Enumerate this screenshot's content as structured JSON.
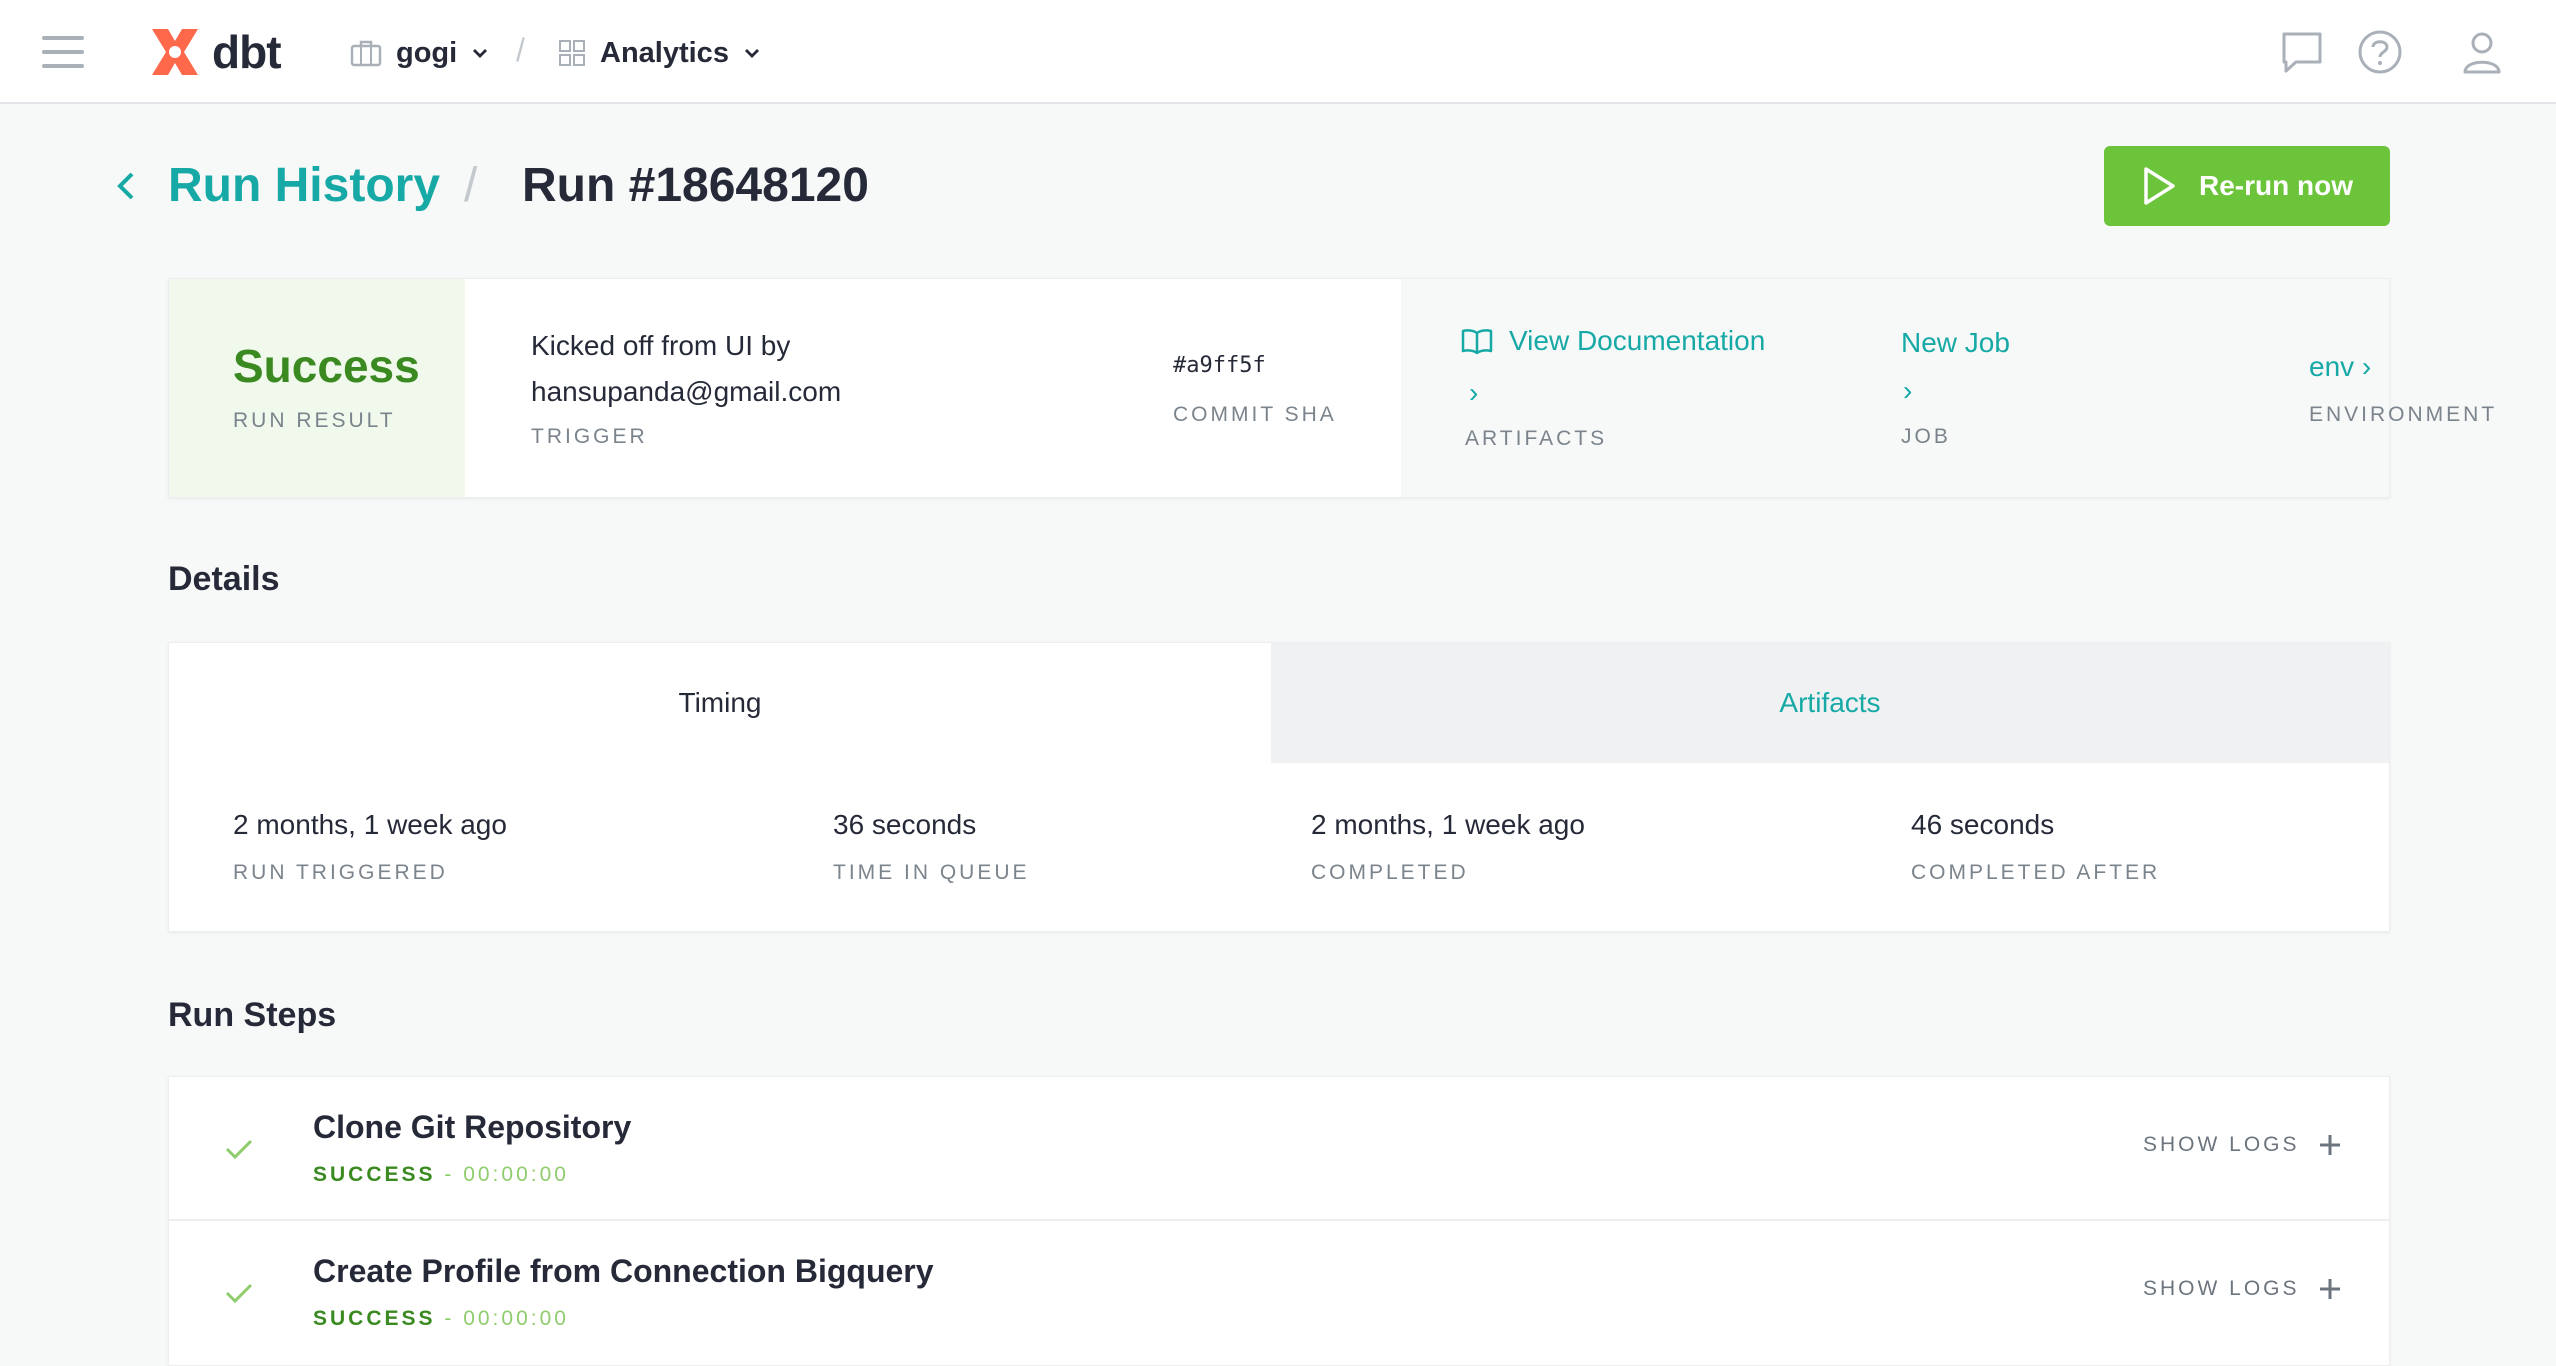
{
  "nav": {
    "logo_text": "dbt",
    "account": "gogi",
    "separator": "/",
    "project": "Analytics",
    "icons": [
      "menu-icon",
      "chat-icon",
      "help-icon",
      "user-icon"
    ],
    "brand_color": "#ff694b"
  },
  "header": {
    "back_link": "Run History",
    "separator": "/",
    "title": "Run #18648120",
    "rerun_label": "Re-run now",
    "rerun_color": "#6bc43a"
  },
  "summary": {
    "result_value": "Success",
    "result_label": "RUN RESULT",
    "trigger_text": "Kicked off from UI by hansupanda@gmail.com",
    "trigger_label": "TRIGGER",
    "commit_sha": "#a9ff5f",
    "commit_label": "COMMIT SHA",
    "artifacts_link": "View Documentation",
    "artifacts_chevron": "›",
    "artifacts_label": "ARTIFACTS",
    "job_link": "New Job",
    "job_chevron": "›",
    "job_label": "JOB",
    "env_link": "env ›",
    "env_label": "ENVIRONMENT"
  },
  "details": {
    "title": "Details",
    "tabs": [
      {
        "label": "Timing",
        "active": true
      },
      {
        "label": "Artifacts",
        "active": false
      }
    ],
    "timing": [
      {
        "value": "2 months, 1 week ago",
        "label": "RUN TRIGGERED"
      },
      {
        "value": "36 seconds",
        "label": "TIME IN QUEUE"
      },
      {
        "value": "2 months, 1 week ago",
        "label": "COMPLETED"
      },
      {
        "value": "46 seconds",
        "label": "COMPLETED AFTER"
      }
    ]
  },
  "steps": {
    "title": "Run Steps",
    "show_logs_label": "SHOW LOGS",
    "items": [
      {
        "name": "Clone Git Repository",
        "status": "SUCCESS",
        "sep": " - ",
        "duration": "00:00:00"
      },
      {
        "name": "Create Profile from Connection Bigquery",
        "status": "SUCCESS",
        "sep": " - ",
        "duration": "00:00:00"
      }
    ]
  },
  "colors": {
    "teal": "#17a9a6",
    "success_green": "#3b8a21",
    "success_bg": "#f1f8ec"
  }
}
